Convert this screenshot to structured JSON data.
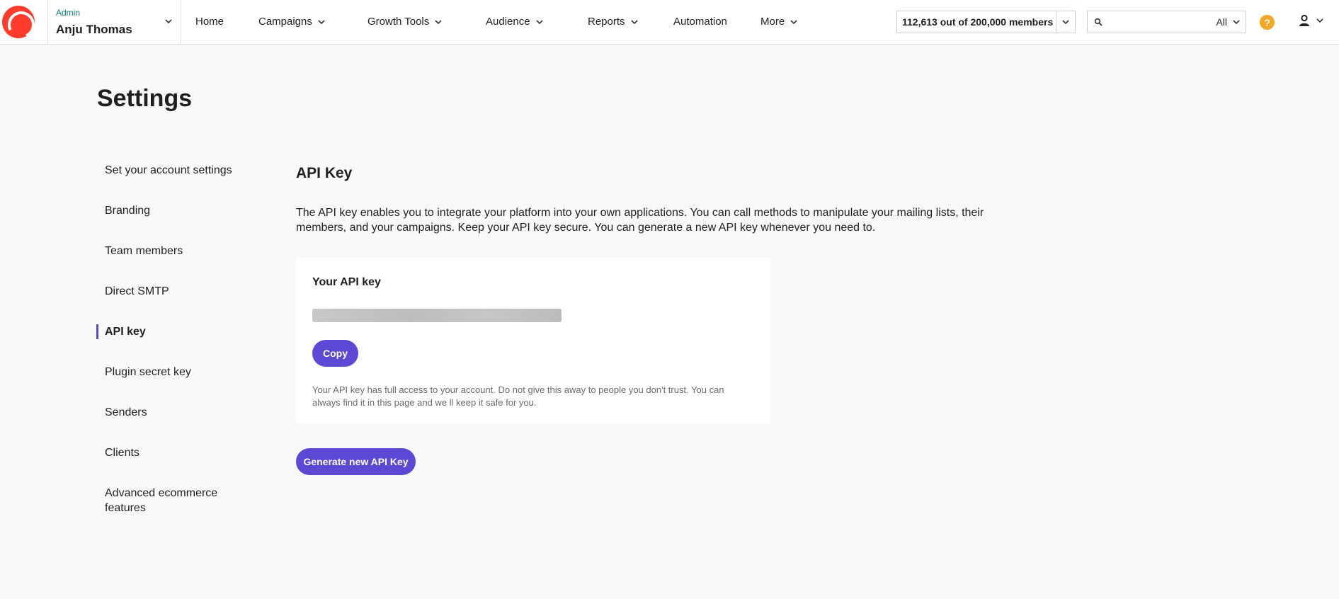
{
  "header": {
    "account": {
      "role": "Admin",
      "name": "Anju Thomas"
    },
    "nav": [
      {
        "label": "Home",
        "has_menu": false
      },
      {
        "label": "Campaigns",
        "has_menu": true
      },
      {
        "label": "Growth Tools",
        "has_menu": true
      },
      {
        "label": "Audience",
        "has_menu": true
      },
      {
        "label": "Reports",
        "has_menu": true
      },
      {
        "label": "Automation",
        "has_menu": false
      },
      {
        "label": "More",
        "has_menu": true
      }
    ],
    "members_usage": "112,613 out of 200,000 members",
    "search": {
      "value": "",
      "placeholder": "",
      "scope": "All"
    },
    "help_icon": "?",
    "colors": {
      "brand": "#ff3b2b",
      "accent": "#5b49d6",
      "help": "#f5a623",
      "role_text": "#0b7a75"
    }
  },
  "page": {
    "title": "Settings"
  },
  "sidebar": {
    "items": [
      {
        "label": "Set your account settings",
        "active": false
      },
      {
        "label": "Branding",
        "active": false
      },
      {
        "label": "Team members",
        "active": false
      },
      {
        "label": "Direct SMTP",
        "active": false
      },
      {
        "label": "API key",
        "active": true
      },
      {
        "label": "Plugin secret key",
        "active": false
      },
      {
        "label": "Senders",
        "active": false
      },
      {
        "label": "Clients",
        "active": false
      },
      {
        "label": "Advanced ecommerce features",
        "active": false
      }
    ]
  },
  "main": {
    "section_title": "API Key",
    "description": "The API key enables you to integrate your platform into your own applications. You can call methods to manipulate your mailing lists, their members, and your campaigns. Keep your API key secure. You can generate a new API key whenever you need to.",
    "card": {
      "title": "Your API key",
      "copy_label": "Copy",
      "note": "Your API key has full access to your account. Do not give this away to people you don't trust. You can always find it in this page and we ll keep it safe for you."
    },
    "generate_label": "Generate new API Key"
  }
}
